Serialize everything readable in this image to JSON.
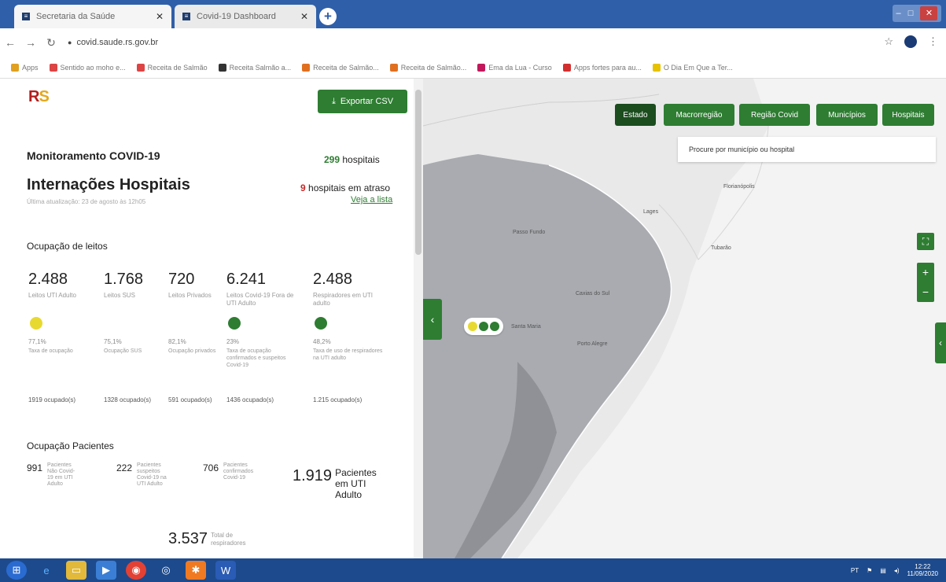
{
  "browser": {
    "tabs": [
      {
        "title": "Secretaria da Saúde",
        "active": true
      },
      {
        "title": "Covid-19 Dashboard",
        "active": false
      }
    ],
    "url": "covid.saude.rs.gov.br",
    "bookmarks": [
      {
        "label": "Apps",
        "color": "#e0a020"
      },
      {
        "label": "Sentido ao moho e...",
        "color": "#d44"
      },
      {
        "label": "Receita de Salmão",
        "color": "#d44"
      },
      {
        "label": "Receita Salmão a...",
        "color": "#333"
      },
      {
        "label": "Receita de Salmão...",
        "color": "#e07020"
      },
      {
        "label": "Receita de Salmão...",
        "color": "#e07020"
      },
      {
        "label": "Ema da Lua - Curso",
        "color": "#c2185b"
      },
      {
        "label": "Apps fortes para au...",
        "color": "#d32f2f"
      },
      {
        "label": "O Dia Em Que a Ter...",
        "color": "#e6c200"
      }
    ]
  },
  "panel": {
    "logo_r": "R",
    "logo_s": "S",
    "export_label": "Exportar CSV",
    "monitor_title": "Monitoramento COVID-19",
    "hospitals_count": "299",
    "hospitals_label": "hospitais",
    "main_title": "Internações Hospitais",
    "late_count": "9",
    "late_label": "hospitais em atraso",
    "see_list": "Veja a lista",
    "last_update": "Última atualização: 23 de agosto às 12h05",
    "beds_title": "Ocupação de leitos",
    "beds": [
      {
        "value": "2.488",
        "label": "Leitos UTI Adulto",
        "dot": "#e8d930",
        "pct": "77,1%",
        "pct_label": "Taxa de ocupação",
        "occupied": "1919 ocupado(s)"
      },
      {
        "value": "1.768",
        "label": "Leitos SUS",
        "dot": "",
        "pct": "75,1%",
        "pct_label": "Ocupação SUS",
        "occupied": "1328 ocupado(s)"
      },
      {
        "value": "720",
        "label": "Leitos Privados",
        "dot": "",
        "pct": "82,1%",
        "pct_label": "Ocupação privados",
        "occupied": "591 ocupado(s)"
      },
      {
        "value": "6.241",
        "label": "Leitos Covid-19 Fora de UTI Adulto",
        "dot": "#2e7d32",
        "pct": "23%",
        "pct_label": "Taxa de ocupação confirmados e suspeitos Covid-19",
        "occupied": "1436 ocupado(s)"
      },
      {
        "value": "2.488",
        "label": "Respiradores em UTI adulto",
        "dot": "#2e7d32",
        "pct": "48,2%",
        "pct_label": "Taxa de uso de respiradores na UTI adulto",
        "occupied": "1.215 ocupado(s)"
      }
    ],
    "patients_title": "Ocupação Pacientes",
    "patients": [
      {
        "value": "991",
        "label": "Pacientes Não Covid-19 em UTI Adulto"
      },
      {
        "value": "222",
        "label": "Pacientes suspeitos Covid-19 na UTI Adulto"
      },
      {
        "value": "706",
        "label": "Pacientes confirmados Covid-19"
      }
    ],
    "patients_total": "1.919",
    "patients_total_label": "Pacientes em UTI Adulto",
    "respirators_total": "3.537",
    "respirators_label": "Total de respiradores"
  },
  "map": {
    "buttons": [
      "Estado",
      "Macrorregião",
      "Região Covid",
      "Municípios",
      "Hospitais"
    ],
    "active": "Estado",
    "search_placeholder": "Procure por município ou hospital",
    "marker_colors": [
      "#e8d930",
      "#2e7d32",
      "#2e7d32"
    ],
    "places": [
      "Florianópolis",
      "Lages",
      "Passo Fundo",
      "Tubarão",
      "Caxias do Sul",
      "Porto Alegre",
      "Santa Maria"
    ]
  },
  "taskbar": {
    "lang": "PT",
    "time": "12:22",
    "date": "11/09/2020"
  }
}
